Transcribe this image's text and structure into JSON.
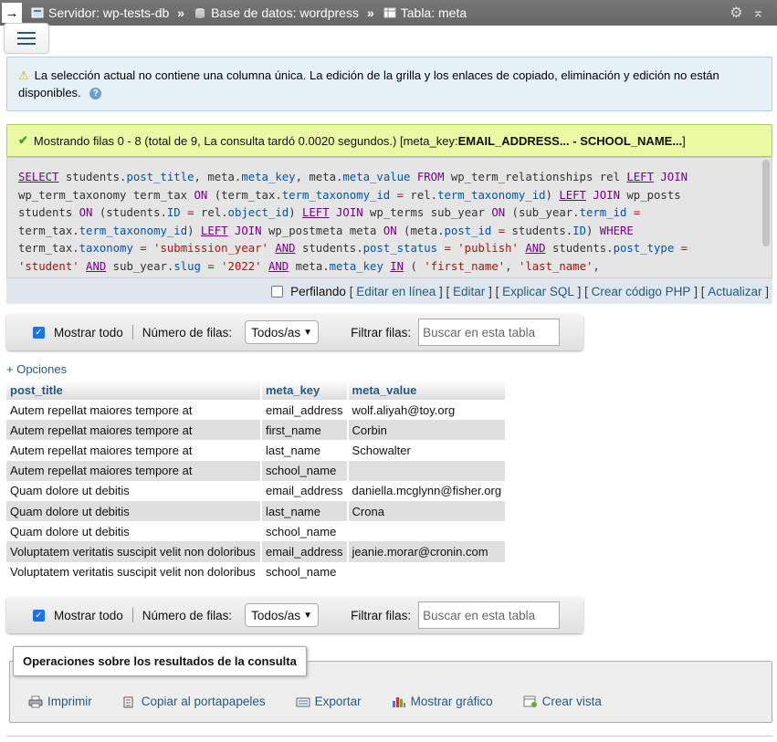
{
  "topbar": {
    "server": "Servidor: wp-tests-db",
    "database": "Base de datos: wordpress",
    "table": "Tabla: meta",
    "sep": "»"
  },
  "notice": {
    "text": "La selección actual no contiene una columna única. La edición de la grilla y los enlaces de copiado, eliminación y edición no están disponibles."
  },
  "success": {
    "prefix": "Mostrando filas 0 - 8 (total de 9, La consulta tardó 0.0020 segundos.) [meta_key: ",
    "bold": "EMAIL_ADDRESS... - SCHOOL_NAME...",
    "suffix": "]"
  },
  "sql_actions": {
    "profiling": "Perfilando",
    "inline_edit": "Editar en línea",
    "edit": "Editar",
    "explain": "Explicar SQL",
    "php": "Crear código PHP",
    "refresh": "Actualizar"
  },
  "nav": {
    "show_all": "Mostrar todo",
    "rows_label": "Número de filas:",
    "rows_value": "Todos/as",
    "filter_label": "Filtrar filas:",
    "search_placeholder": "Buscar en esta tabla"
  },
  "options_link": "+ Opciones",
  "table": {
    "headers": [
      "post_title",
      "meta_key",
      "meta_value"
    ],
    "rows": [
      [
        "Autem repellat maiores tempore at",
        "email_address",
        "wolf.aliyah@toy.org"
      ],
      [
        "Autem repellat maiores tempore at",
        "first_name",
        "Corbin"
      ],
      [
        "Autem repellat maiores tempore at",
        "last_name",
        "Schowalter"
      ],
      [
        "Autem repellat maiores tempore at",
        "school_name",
        ""
      ],
      [
        "Quam dolore ut debitis",
        "email_address",
        "daniella.mcglynn@fisher.org"
      ],
      [
        "Quam dolore ut debitis",
        "last_name",
        "Crona"
      ],
      [
        "Quam dolore ut debitis",
        "school_name",
        ""
      ],
      [
        "Voluptatem veritatis suscipit velit non doloribus",
        "email_address",
        "jeanie.morar@cronin.com"
      ],
      [
        "Voluptatem veritatis suscipit velit non doloribus",
        "school_name",
        ""
      ]
    ]
  },
  "operations": {
    "title": "Operaciones sobre los resultados de la consulta",
    "print": "Imprimir",
    "copy": "Copiar al portapapeles",
    "export": "Exportar",
    "chart": "Mostrar gráfico",
    "view": "Crear vista"
  }
}
